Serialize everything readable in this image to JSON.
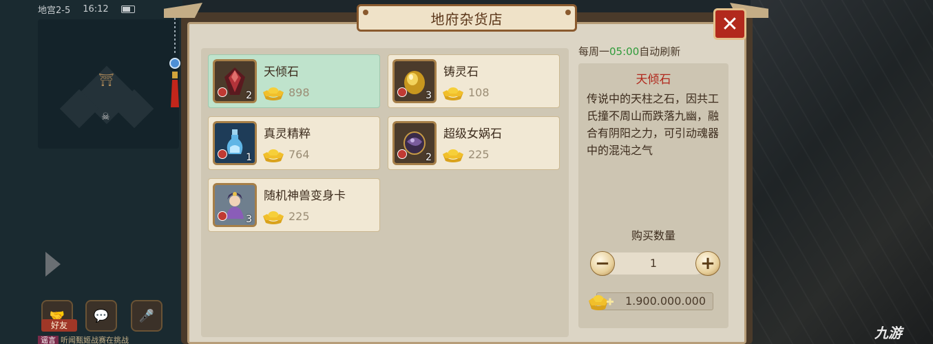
{
  "status_bar": {
    "location": "地宫2-5",
    "time": "16:12"
  },
  "shop": {
    "title": "地府杂货店",
    "refresh": {
      "prefix": "每周一",
      "time": "05:00",
      "suffix": "自动刷新"
    },
    "items": [
      {
        "name": "天倾石",
        "qty": "2",
        "price": "898",
        "icon": "crimson-crystal-icon",
        "selected": true
      },
      {
        "name": "铸灵石",
        "qty": "3",
        "price": "108",
        "icon": "golden-orb-icon",
        "selected": false
      },
      {
        "name": "真灵精粹",
        "qty": "1",
        "price": "764",
        "icon": "blue-vial-icon",
        "selected": false
      },
      {
        "name": "超级女娲石",
        "qty": "2",
        "price": "225",
        "icon": "purple-stone-icon",
        "selected": false
      },
      {
        "name": "随机神兽变身卡",
        "qty": "3",
        "price": "225",
        "icon": "hero-card-icon",
        "selected": false
      }
    ],
    "detail": {
      "title": "天倾石",
      "description": "传说中的天柱之石，因共工氏撞不周山而跌落九幽，融合有阴阳之力，可引动魂器中的混沌之气"
    },
    "purchase": {
      "label": "购买数量",
      "quantity": "1",
      "total": "1.900.000.000"
    }
  },
  "hud": {
    "friend_label": "好友",
    "chat_tag": "谣言",
    "chat_text": "听闻甄姬战赛在挑战"
  },
  "colors": {
    "accent_red": "#b2291d",
    "refresh_green": "#2f9b3a",
    "selected_card": "#bfe3cc"
  },
  "watermark": "九游"
}
